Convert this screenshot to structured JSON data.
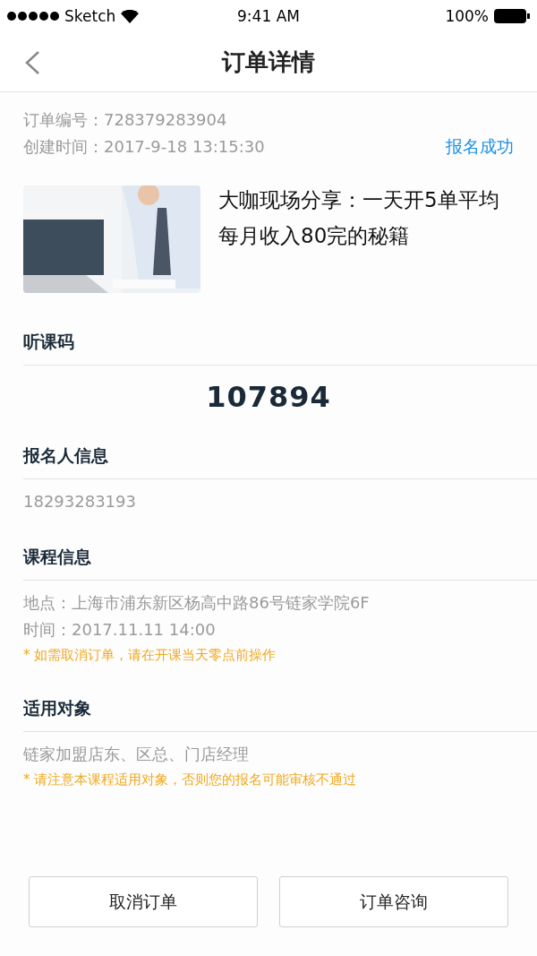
{
  "status_bar": {
    "carrier": "Sketch",
    "time": "9:41 AM",
    "battery": "100%"
  },
  "nav": {
    "title": "订单详情"
  },
  "order": {
    "number_label": "订单编号：",
    "number": "728379283904",
    "created_label": "创建时间：",
    "created": "2017-9-18 13:15:30",
    "status": "报名成功"
  },
  "course": {
    "title": "大咖现场分享：一天开5单平均每月收入80完的秘籍"
  },
  "sections": [
    {
      "kind": "code",
      "heading": "听课码",
      "code": "107894"
    },
    {
      "kind": "info",
      "heading": "报名人信息",
      "lines": [
        "18293283193"
      ]
    },
    {
      "kind": "info",
      "heading": "课程信息",
      "lines": [
        "地点：上海市浦东新区杨高中路86号链家学院6F",
        "时间：2017.11.11 14:00"
      ],
      "note": "* 如需取消订单，请在开课当天零点前操作"
    },
    {
      "kind": "info",
      "heading": "适用对象",
      "lines": [
        "链家加盟店东、区总、门店经理"
      ],
      "note": "* 请注意本课程适用对象，否则您的报名可能审核不通过"
    }
  ],
  "buttons": [
    "取消订单",
    "订单咨询"
  ]
}
